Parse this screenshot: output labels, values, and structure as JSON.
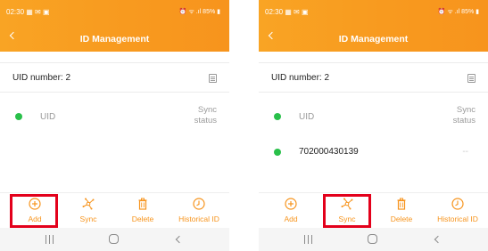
{
  "screens": [
    {
      "status_bar": {
        "time": "02:30",
        "notification_icons": "▦ ✉ ▣",
        "right": "⏰ ᯤ .ıl 85% ▮"
      },
      "app_bar": {
        "title": "ID Management"
      },
      "uid_count": "UID number: 2",
      "columns": {
        "uid": "UID",
        "sync_status": [
          "Sync",
          "status"
        ]
      },
      "rows": [],
      "toolbar": {
        "add": "Add",
        "sync": "Sync",
        "delete": "Delete",
        "historical": "Historical ID"
      },
      "highlighted": "add"
    },
    {
      "status_bar": {
        "time": "02:30",
        "notification_icons": "▦ ✉ ▣",
        "right": "⏰ ᯤ .ıl 85% ▮"
      },
      "app_bar": {
        "title": "ID Management"
      },
      "uid_count": "UID number: 2",
      "columns": {
        "uid": "UID",
        "sync_status": [
          "Sync",
          "status"
        ]
      },
      "rows": [
        {
          "uid": "702000430139",
          "status": "--"
        }
      ],
      "toolbar": {
        "add": "Add",
        "sync": "Sync",
        "delete": "Delete",
        "historical": "Historical ID"
      },
      "highlighted": "sync"
    }
  ],
  "colors": {
    "accent": "#f7941d",
    "status_dot": "#29c04a",
    "highlight": "#e3001b"
  },
  "icons": {
    "add": "plus-circle-icon",
    "sync": "sync-network-icon",
    "delete": "trash-icon",
    "historical": "clock-icon",
    "list": "list-icon"
  }
}
